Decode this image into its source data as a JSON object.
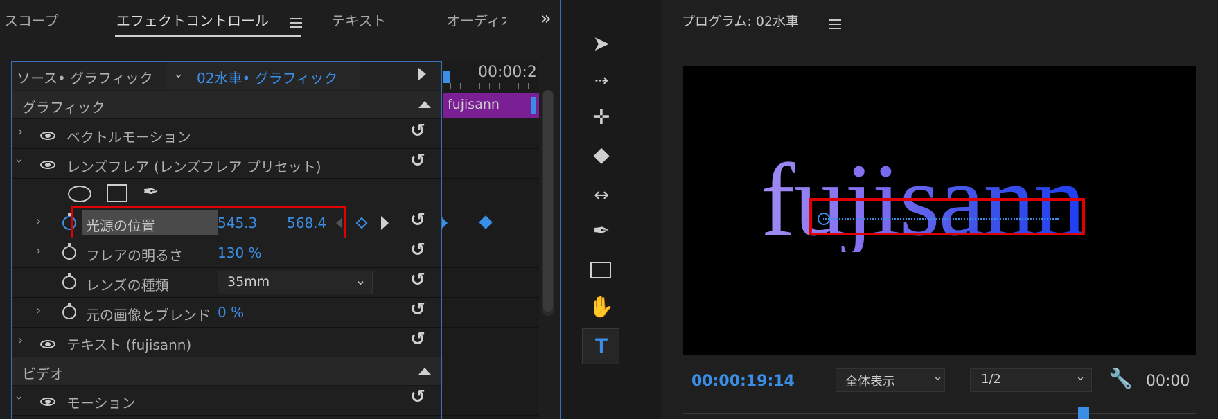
{
  "left_panel": {
    "tabs": [
      "スコープ",
      "エフェクトコントロール",
      "テキスト",
      "オーディオ"
    ],
    "overflow": "»",
    "source_label": "ソース• グラフィック",
    "source_dropdown": "02水車• グラフィック",
    "timecode": "00:00:2",
    "clip_label": "fujisann",
    "section_graphic": "グラフィック",
    "section_video": "ビデオ",
    "rows": {
      "vector_motion": "ベクトルモーション",
      "lens_flare": "レンズフレア (レンズフレア プリセット)",
      "light_position_label": "光源の位置",
      "light_x": "545.3",
      "light_y": "568.4",
      "flare_brightness_label": "フレアの明るさ",
      "flare_brightness_value": "130 %",
      "lens_type_label": "レンズの種類",
      "lens_type_value": "35mm",
      "blend_label": "元の画像とブレンド",
      "blend_value": "0 %",
      "text_label": "テキスト (fujisann)",
      "motion_label": "モーション"
    }
  },
  "program": {
    "title": "プログラム: 02水車",
    "preview_text": "fujisann",
    "timecode": "00:00:19:14",
    "zoom_value": "全体表示",
    "resolution_value": "1/2",
    "right_time": "00:00"
  },
  "colors": {
    "accent_blue": "#3a8ee6",
    "highlight_red": "#e00000",
    "clip_purple": "#7a1f94"
  }
}
